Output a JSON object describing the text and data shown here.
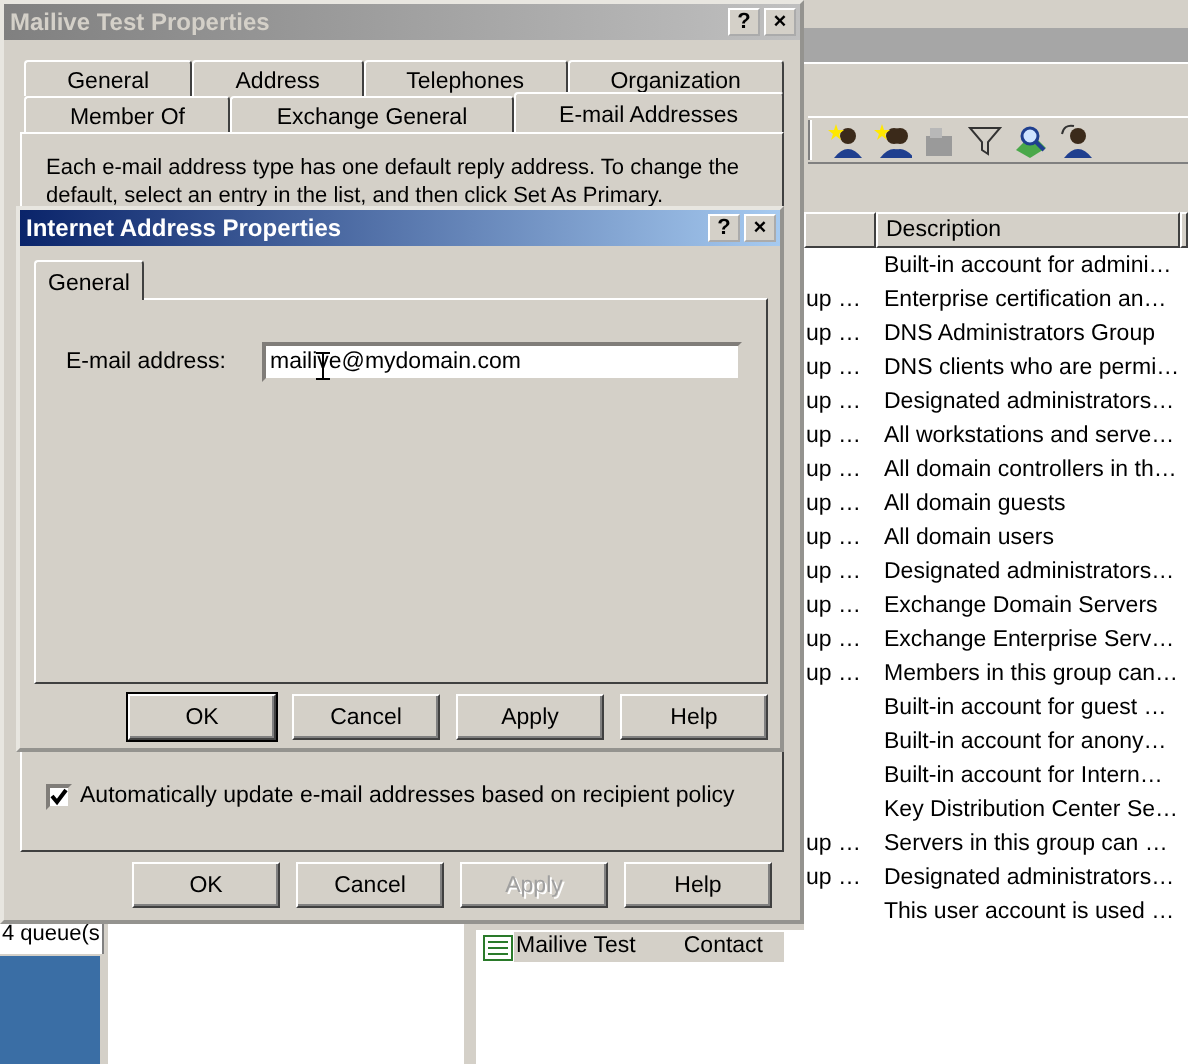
{
  "background_window": {
    "header": {
      "description": "Description"
    },
    "rows": [
      {
        "column_1": "",
        "description": "Built-in account for admini…"
      },
      {
        "column_1": "up …",
        "description": "Enterprise certification an…"
      },
      {
        "column_1": "up …",
        "description": "DNS Administrators Group"
      },
      {
        "column_1": "up …",
        "description": "DNS clients who are permi…"
      },
      {
        "column_1": "up …",
        "description": "Designated administrators…"
      },
      {
        "column_1": "up …",
        "description": "All workstations and serve…"
      },
      {
        "column_1": "up …",
        "description": "All domain controllers in th…"
      },
      {
        "column_1": "up …",
        "description": "All domain guests"
      },
      {
        "column_1": "up …",
        "description": "All domain users"
      },
      {
        "column_1": "up …",
        "description": "Designated administrators…"
      },
      {
        "column_1": "up …",
        "description": "Exchange Domain Servers"
      },
      {
        "column_1": "up …",
        "description": "Exchange Enterprise Serv…"
      },
      {
        "column_1": "up …",
        "description": "Members in this group can…"
      },
      {
        "column_1": "",
        "description": "Built-in account for guest …"
      },
      {
        "column_1": "",
        "description": "Built-in account for anony…"
      },
      {
        "column_1": "",
        "description": "Built-in account for Intern…"
      },
      {
        "column_1": "",
        "description": "Key Distribution Center Se…"
      },
      {
        "column_1": "up …",
        "description": "Servers in this group can …"
      },
      {
        "column_1": "up …",
        "description": "Designated administrators…"
      },
      {
        "column_1": "",
        "description": "This user account is used …"
      }
    ],
    "queue_status": "4 queue(s",
    "lower_list": [
      {
        "name": "Mailive Test",
        "type": "Contact"
      }
    ]
  },
  "properties_dialog": {
    "title": "Mailive Test Properties",
    "title_buttons": [
      "?",
      "×"
    ],
    "tab_rows": [
      [
        {
          "label": "General",
          "selected": false
        },
        {
          "label": "Address",
          "selected": false
        },
        {
          "label": "Telephones",
          "selected": false
        },
        {
          "label": "Organization",
          "selected": false
        }
      ],
      [
        {
          "label": "Member Of",
          "selected": false
        },
        {
          "label": "Exchange General",
          "selected": false
        },
        {
          "label": "E-mail Addresses",
          "selected": true
        }
      ]
    ],
    "intro_lines": [
      "Each e-mail address type has one default reply address. To change the",
      "default, select an entry in the list, and then click Set As Primary."
    ],
    "checkbox": {
      "label": "Automatically update e-mail addresses based on recipient policy",
      "checked": true
    },
    "buttons": [
      {
        "label": "OK",
        "disabled": false
      },
      {
        "label": "Cancel",
        "disabled": false
      },
      {
        "label": "Apply",
        "disabled": true
      },
      {
        "label": "Help",
        "disabled": false
      }
    ]
  },
  "address_dialog": {
    "title": "Internet Address Properties",
    "title_buttons": [
      "?",
      "×"
    ],
    "tabs": [
      {
        "label": "General",
        "selected": true
      }
    ],
    "field": {
      "label": "E-mail address:",
      "value": "mailive@mydomain.com"
    },
    "buttons": [
      {
        "label": "OK",
        "default": true
      },
      {
        "label": "Cancel",
        "default": false
      },
      {
        "label": "Apply",
        "default": false
      },
      {
        "label": "Help",
        "default": false
      }
    ]
  }
}
